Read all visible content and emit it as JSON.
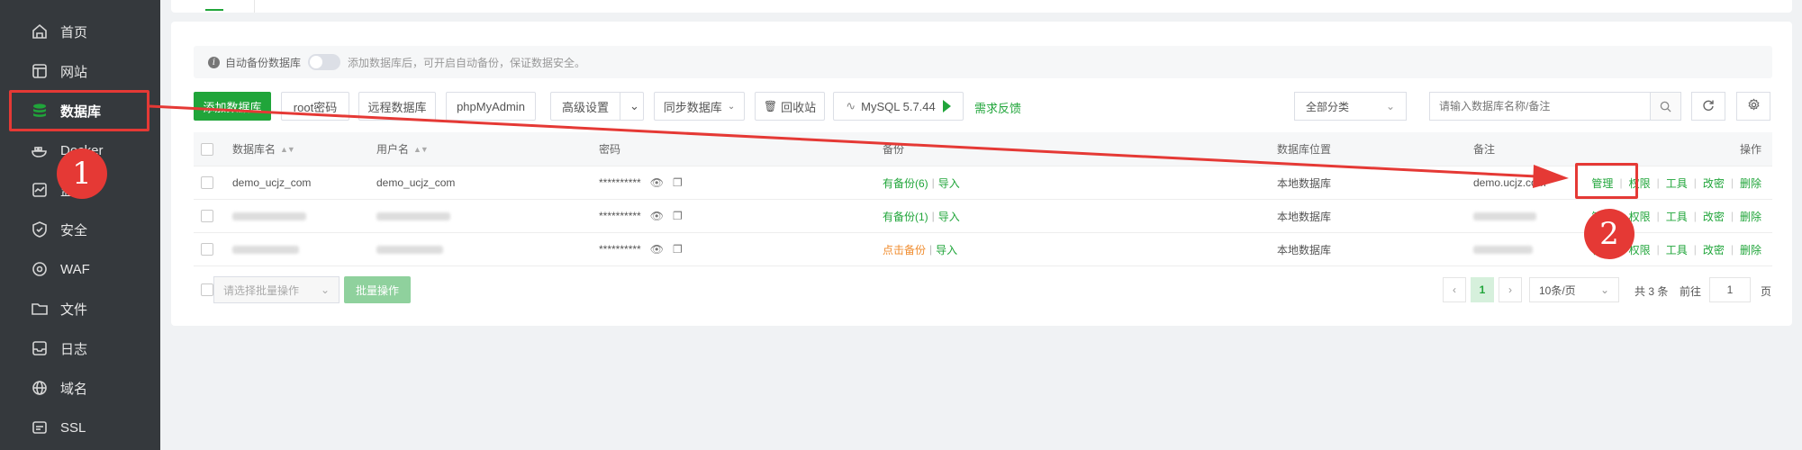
{
  "sidebar": {
    "items": [
      {
        "label": "首页",
        "icon": "home-icon"
      },
      {
        "label": "网站",
        "icon": "website-icon"
      },
      {
        "label": "数据库",
        "icon": "database-icon",
        "active": true
      },
      {
        "label": "Docker",
        "icon": "docker-icon"
      },
      {
        "label": "监控",
        "icon": "monitor-icon"
      },
      {
        "label": "安全",
        "icon": "shield-icon"
      },
      {
        "label": "WAF",
        "icon": "waf-icon"
      },
      {
        "label": "文件",
        "icon": "folder-icon"
      },
      {
        "label": "日志",
        "icon": "log-icon"
      },
      {
        "label": "域名",
        "icon": "globe-icon"
      },
      {
        "label": "SSL",
        "icon": "ssl-icon"
      }
    ]
  },
  "notice": {
    "label": "自动备份数据库",
    "hint": "添加数据库后，可开启自动备份，保证数据安全。"
  },
  "toolbar": {
    "add_db": "添加数据库",
    "root_pwd": "root密码",
    "remote_db": "远程数据库",
    "phpmyadmin": "phpMyAdmin",
    "advanced": "高级设置",
    "sync_db": "同步数据库",
    "recycle": "回收站",
    "mysql_version": "MySQL 5.7.44",
    "feedback": "需求反馈",
    "category": "全部分类",
    "search_placeholder": "请输入数据库名称/备注"
  },
  "table": {
    "headers": {
      "name": "数据库名",
      "user": "用户名",
      "password": "密码",
      "backup": "备份",
      "location": "数据库位置",
      "remark": "备注",
      "ops": "操作"
    },
    "rows": [
      {
        "name": "demo_ucjz_com",
        "user": "demo_ucjz_com",
        "password": "**********",
        "backup": "有备份(6)",
        "import": "导入",
        "location": "本地数据库",
        "remark": "demo.ucjz.com"
      },
      {
        "name": "",
        "user": "",
        "password": "**********",
        "backup": "有备份(1)",
        "import": "导入",
        "location": "本地数据库",
        "remark": ""
      },
      {
        "name": "",
        "user": "",
        "password": "**********",
        "backup": "点击备份",
        "import": "导入",
        "location": "本地数据库",
        "remark": ""
      }
    ],
    "ops": [
      "管理",
      "权限",
      "工具",
      "改密",
      "删除"
    ]
  },
  "footer": {
    "batch_placeholder": "请选择批量操作",
    "batch_button": "批量操作",
    "current_page": "1",
    "per_page": "10条/页",
    "total": "共 3 条",
    "goto": "前往",
    "page_input": "1",
    "page_suffix": "页"
  },
  "annotations": {
    "step1": "1",
    "step2": "2"
  },
  "colors": {
    "accent": "#20a53a",
    "annotation": "#e53935",
    "sidebar": "#35393d"
  }
}
